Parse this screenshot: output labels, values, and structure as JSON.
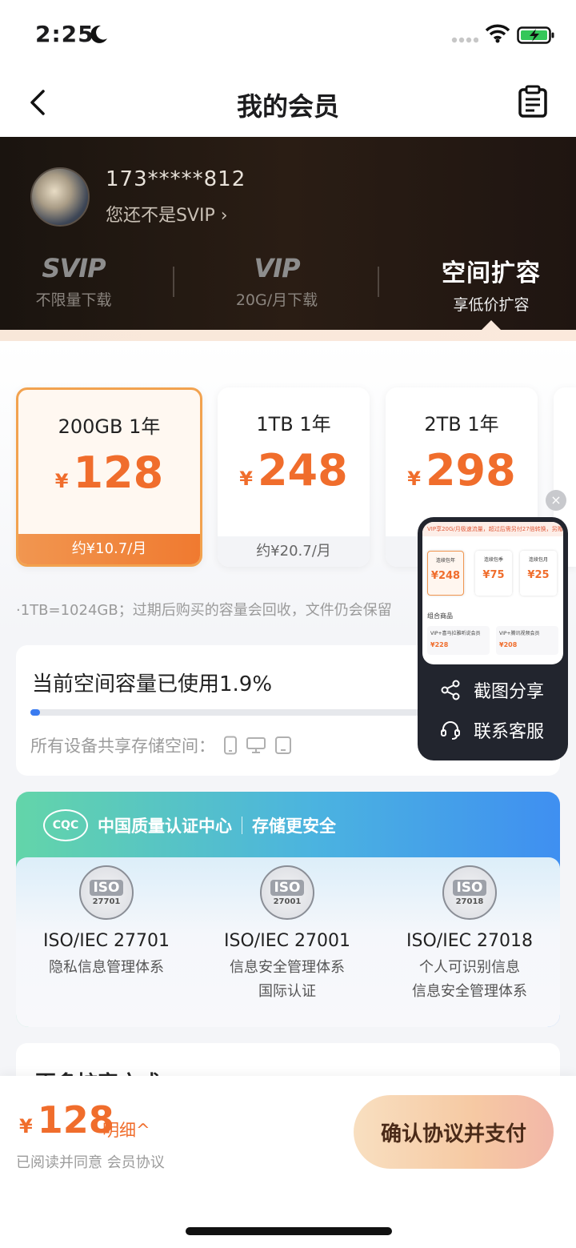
{
  "status": {
    "time": "2:25"
  },
  "nav": {
    "title": "我的会员"
  },
  "user": {
    "phone": "173*****812",
    "status_text": "您还不是SVIP"
  },
  "tiers": [
    {
      "logo": "SVIP",
      "sub": "不限量下载"
    },
    {
      "logo": "VIP",
      "sub": "20G/月下载"
    },
    {
      "logo": "空间扩容",
      "sub": "享低价扩容"
    }
  ],
  "plans": [
    {
      "name": "200GB 1年",
      "currency": "¥",
      "price": "128",
      "monthly": "约¥10.7/月"
    },
    {
      "name": "1TB 1年",
      "currency": "¥",
      "price": "248",
      "monthly": "约¥20.7/月"
    },
    {
      "name": "2TB 1年",
      "currency": "¥",
      "price": "298",
      "monthly": ""
    }
  ],
  "note": "·1TB=1024GB；过期后购买的容量会回收，文件仍会保留",
  "usage": {
    "title": "当前空间容量已使用1.9%",
    "percent": 1.9,
    "devices_label": "所有设备共享存储空间："
  },
  "cert": {
    "org_logo": "CQC",
    "org": "中国质量认证中心",
    "slogan": "存储更安全",
    "items": [
      {
        "badge": "ISO",
        "badge_num": "27701",
        "standard": "ISO/IEC 27701",
        "desc1": "隐私信息管理体系",
        "desc2": ""
      },
      {
        "badge": "ISO",
        "badge_num": "27001",
        "standard": "ISO/IEC 27001",
        "desc1": "信息安全管理体系",
        "desc2": "国际认证"
      },
      {
        "badge": "ISO",
        "badge_num": "27018",
        "standard": "ISO/IEC 27018",
        "desc1": "个人可识别信息",
        "desc2": "信息安全管理体系"
      }
    ]
  },
  "more": {
    "title": "更多扩容方式"
  },
  "bottom": {
    "currency": "¥",
    "total": "128",
    "detail": "明细^",
    "agree": "已阅读并同意 会员协议",
    "pay_button": "确认协议并支付"
  },
  "popup": {
    "banner": "VIP享20G/月极速流量，超过后需另付27倍转换，另赠空间500G",
    "mini_plans": [
      {
        "name": "连续包年",
        "price": "¥248"
      },
      {
        "name": "连续包季",
        "price": "¥75"
      },
      {
        "name": "连续包月",
        "price": "¥25"
      }
    ],
    "combo_title": "组合商品",
    "combo_items": [
      {
        "name": "VIP+喜马拉雅听说会员",
        "price": "¥228"
      },
      {
        "name": "VIP+腾讯视频会员",
        "price": "¥208"
      }
    ],
    "share_label": "截图分享",
    "service_label": "联系客服",
    "close": "×"
  }
}
